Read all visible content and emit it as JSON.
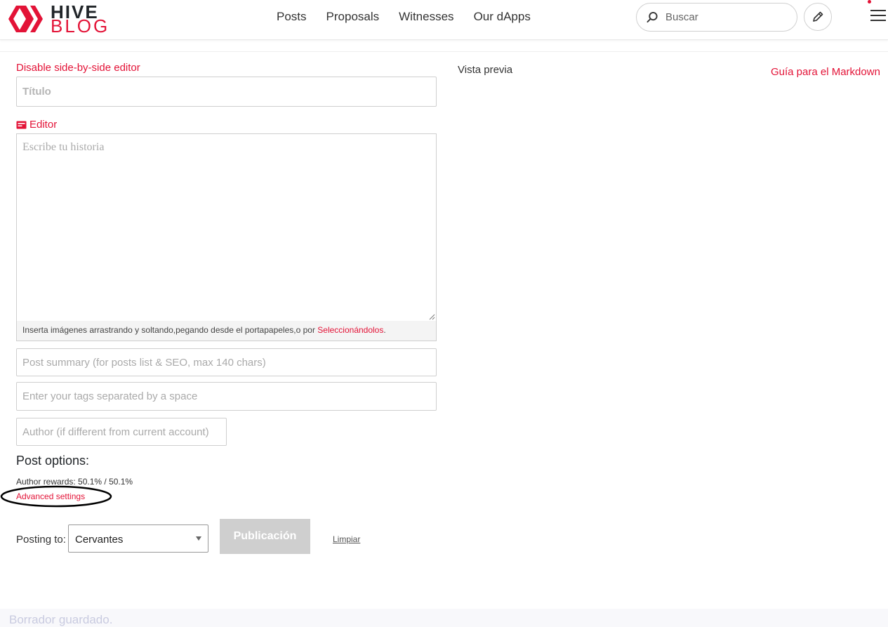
{
  "header": {
    "logo_line1": "HIVE",
    "logo_line2": "BLOG",
    "nav": [
      "Posts",
      "Proposals",
      "Witnesses",
      "Our dApps"
    ],
    "search_placeholder": "Buscar"
  },
  "editor": {
    "disable_side_by_side": "Disable side-by-side editor",
    "title_placeholder": "Título",
    "editor_label": "Editor",
    "body_placeholder": "Escribe tu historia",
    "drop_text": "Inserta imágenes arrastrando y soltando,pegando desde el portapapeles,o por ",
    "drop_link": "Seleccionándolos",
    "drop_end": ".",
    "summary_placeholder": "Post summary (for posts list & SEO, max 140 chars)",
    "tags_placeholder": "Enter your tags separated by a space",
    "author_placeholder": "Author (if different from current account)",
    "post_options": "Post options:",
    "rewards": "Author rewards: 50.1% / 50.1%",
    "advanced_settings": "Advanced settings",
    "posting_to_label": "Posting to:",
    "posting_to_value": "Cervantes",
    "publish": "Publicación",
    "clear": "Limpiar"
  },
  "preview": {
    "title": "Vista previa",
    "markdown_guide": "Guía para el Markdown"
  },
  "footer": {
    "draft_saved": "Borrador guardado."
  },
  "colors": {
    "brand_red": "#e31337",
    "disabled_button": "#cfcfcf"
  }
}
